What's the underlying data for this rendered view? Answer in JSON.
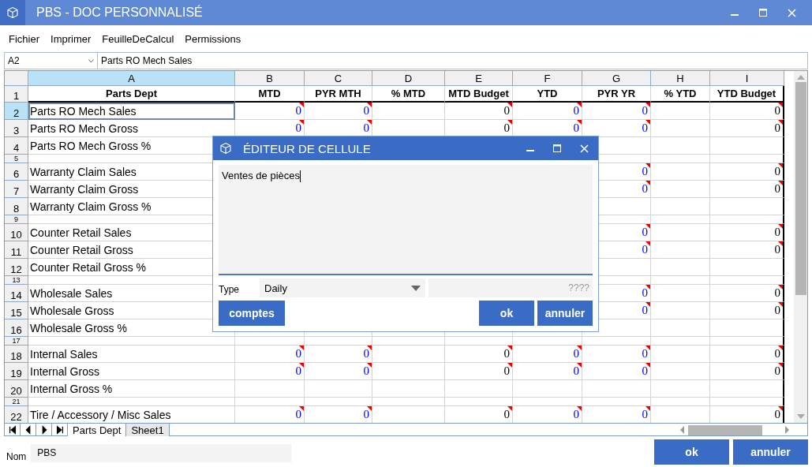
{
  "window": {
    "title": "PBS - DOC PERSONNALISÉ"
  },
  "menu": [
    "Fichier",
    "Imprimer",
    "FeuilleDeCalcul",
    "Permissions"
  ],
  "name_box": {
    "value": "A2"
  },
  "formula_bar": {
    "value": "Parts RO Mech Sales"
  },
  "columns": [
    {
      "letter": "A",
      "selected": true
    },
    {
      "letter": "B",
      "selected": false
    },
    {
      "letter": "C",
      "selected": false
    },
    {
      "letter": "D",
      "selected": false
    },
    {
      "letter": "E",
      "selected": false
    },
    {
      "letter": "F",
      "selected": false
    },
    {
      "letter": "G",
      "selected": false
    },
    {
      "letter": "H",
      "selected": false
    },
    {
      "letter": "I",
      "selected": false
    }
  ],
  "rows": [
    {
      "number": "1",
      "kind": "header",
      "selected": false,
      "cells": [
        {
          "kind": "text",
          "value": "Parts Dept"
        },
        {
          "kind": "text",
          "value": "MTD"
        },
        {
          "kind": "text",
          "value": "PYR MTH"
        },
        {
          "kind": "text",
          "value": "% MTD"
        },
        {
          "kind": "text",
          "value": "MTD Budget"
        },
        {
          "kind": "text",
          "value": "YTD"
        },
        {
          "kind": "text",
          "value": "PYR YR"
        },
        {
          "kind": "text",
          "value": "% YTD"
        },
        {
          "kind": "text",
          "value": "YTD Budget"
        }
      ]
    },
    {
      "number": "2",
      "kind": "data",
      "selected": true,
      "cells": [
        {
          "kind": "text",
          "value": "Parts RO Mech Sales"
        },
        {
          "kind": "number",
          "value": "0",
          "color": "#0000ff"
        },
        {
          "kind": "number",
          "value": "0",
          "color": "#0000ff"
        },
        {
          "kind": "empty"
        },
        {
          "kind": "number",
          "value": "0",
          "color": "#000000"
        },
        {
          "kind": "number",
          "value": "0",
          "color": "#0000ff"
        },
        {
          "kind": "number",
          "value": "0",
          "color": "#0000ff"
        },
        {
          "kind": "empty"
        },
        {
          "kind": "number",
          "value": "0",
          "color": "#000000"
        }
      ]
    },
    {
      "number": "3",
      "kind": "data",
      "selected": false,
      "cells": [
        {
          "kind": "text",
          "value": "Parts RO Mech Gross"
        },
        {
          "kind": "number",
          "value": "0",
          "color": "#0000ff"
        },
        {
          "kind": "number",
          "value": "0",
          "color": "#0000ff"
        },
        {
          "kind": "empty"
        },
        {
          "kind": "number",
          "value": "0",
          "color": "#000000"
        },
        {
          "kind": "number",
          "value": "0",
          "color": "#0000ff"
        },
        {
          "kind": "number",
          "value": "0",
          "color": "#0000ff"
        },
        {
          "kind": "empty"
        },
        {
          "kind": "number",
          "value": "0",
          "color": "#000000"
        }
      ]
    },
    {
      "number": "4",
      "kind": "data",
      "selected": false,
      "cells": [
        {
          "kind": "text",
          "value": "Parts RO Mech Gross %"
        },
        {
          "kind": "hidden"
        },
        {
          "kind": "hidden"
        },
        {
          "kind": "hidden"
        },
        {
          "kind": "hidden"
        },
        {
          "kind": "hidden"
        },
        {
          "kind": "empty"
        },
        {
          "kind": "empty"
        },
        {
          "kind": "empty"
        }
      ]
    },
    {
      "number": "5",
      "kind": "spacer",
      "selected": false,
      "cells": [
        {
          "kind": "empty"
        },
        {
          "kind": "hidden"
        },
        {
          "kind": "hidden"
        },
        {
          "kind": "hidden"
        },
        {
          "kind": "hidden"
        },
        {
          "kind": "hidden"
        },
        {
          "kind": "empty"
        },
        {
          "kind": "empty"
        },
        {
          "kind": "empty"
        }
      ]
    },
    {
      "number": "6",
      "kind": "data",
      "selected": false,
      "cells": [
        {
          "kind": "text",
          "value": "Warranty Claim Sales"
        },
        {
          "kind": "hidden"
        },
        {
          "kind": "hidden"
        },
        {
          "kind": "hidden"
        },
        {
          "kind": "hidden"
        },
        {
          "kind": "hidden"
        },
        {
          "kind": "number",
          "value": "0",
          "color": "#0000ff"
        },
        {
          "kind": "empty"
        },
        {
          "kind": "number",
          "value": "0",
          "color": "#000000"
        }
      ]
    },
    {
      "number": "7",
      "kind": "data",
      "selected": false,
      "cells": [
        {
          "kind": "text",
          "value": "Warranty Claim Gross"
        },
        {
          "kind": "hidden"
        },
        {
          "kind": "hidden"
        },
        {
          "kind": "hidden"
        },
        {
          "kind": "hidden"
        },
        {
          "kind": "hidden"
        },
        {
          "kind": "number",
          "value": "0",
          "color": "#0000ff"
        },
        {
          "kind": "empty"
        },
        {
          "kind": "number",
          "value": "0",
          "color": "#000000"
        }
      ]
    },
    {
      "number": "8",
      "kind": "data",
      "selected": false,
      "cells": [
        {
          "kind": "text",
          "value": "Warranty Claim Gross %"
        },
        {
          "kind": "hidden"
        },
        {
          "kind": "hidden"
        },
        {
          "kind": "hidden"
        },
        {
          "kind": "hidden"
        },
        {
          "kind": "hidden"
        },
        {
          "kind": "empty"
        },
        {
          "kind": "empty"
        },
        {
          "kind": "empty"
        }
      ]
    },
    {
      "number": "9",
      "kind": "spacer",
      "selected": false,
      "cells": [
        {
          "kind": "empty"
        },
        {
          "kind": "hidden"
        },
        {
          "kind": "hidden"
        },
        {
          "kind": "hidden"
        },
        {
          "kind": "hidden"
        },
        {
          "kind": "hidden"
        },
        {
          "kind": "empty"
        },
        {
          "kind": "empty"
        },
        {
          "kind": "empty"
        }
      ]
    },
    {
      "number": "10",
      "kind": "data",
      "selected": false,
      "cells": [
        {
          "kind": "text",
          "value": "Counter Retail Sales"
        },
        {
          "kind": "hidden"
        },
        {
          "kind": "hidden"
        },
        {
          "kind": "hidden"
        },
        {
          "kind": "hidden"
        },
        {
          "kind": "hidden"
        },
        {
          "kind": "number",
          "value": "0",
          "color": "#0000ff"
        },
        {
          "kind": "empty"
        },
        {
          "kind": "number",
          "value": "0",
          "color": "#000000"
        }
      ]
    },
    {
      "number": "11",
      "kind": "data",
      "selected": false,
      "cells": [
        {
          "kind": "text",
          "value": "Counter Retail Gross"
        },
        {
          "kind": "hidden"
        },
        {
          "kind": "hidden"
        },
        {
          "kind": "hidden"
        },
        {
          "kind": "hidden"
        },
        {
          "kind": "hidden"
        },
        {
          "kind": "number",
          "value": "0",
          "color": "#0000ff"
        },
        {
          "kind": "empty"
        },
        {
          "kind": "number",
          "value": "0",
          "color": "#000000"
        }
      ]
    },
    {
      "number": "12",
      "kind": "data",
      "selected": false,
      "cells": [
        {
          "kind": "text",
          "value": "Counter Retail Gross %"
        },
        {
          "kind": "hidden"
        },
        {
          "kind": "hidden"
        },
        {
          "kind": "hidden"
        },
        {
          "kind": "hidden"
        },
        {
          "kind": "hidden"
        },
        {
          "kind": "empty"
        },
        {
          "kind": "empty"
        },
        {
          "kind": "empty"
        }
      ]
    },
    {
      "number": "13",
      "kind": "spacer",
      "selected": false,
      "cells": [
        {
          "kind": "empty"
        },
        {
          "kind": "hidden"
        },
        {
          "kind": "hidden"
        },
        {
          "kind": "hidden"
        },
        {
          "kind": "hidden"
        },
        {
          "kind": "hidden"
        },
        {
          "kind": "empty"
        },
        {
          "kind": "empty"
        },
        {
          "kind": "empty"
        }
      ]
    },
    {
      "number": "14",
      "kind": "data",
      "selected": false,
      "cells": [
        {
          "kind": "text",
          "value": "Wholesale Sales"
        },
        {
          "kind": "hidden"
        },
        {
          "kind": "hidden"
        },
        {
          "kind": "hidden"
        },
        {
          "kind": "hidden"
        },
        {
          "kind": "hidden"
        },
        {
          "kind": "number",
          "value": "0",
          "color": "#0000ff"
        },
        {
          "kind": "empty"
        },
        {
          "kind": "number",
          "value": "0",
          "color": "#000000"
        }
      ]
    },
    {
      "number": "15",
      "kind": "data",
      "selected": false,
      "cells": [
        {
          "kind": "text",
          "value": "Wholesale Gross"
        },
        {
          "kind": "hidden"
        },
        {
          "kind": "hidden"
        },
        {
          "kind": "hidden"
        },
        {
          "kind": "hidden"
        },
        {
          "kind": "hidden"
        },
        {
          "kind": "number",
          "value": "0",
          "color": "#0000ff"
        },
        {
          "kind": "empty"
        },
        {
          "kind": "number",
          "value": "0",
          "color": "#000000"
        }
      ]
    },
    {
      "number": "16",
      "kind": "data",
      "selected": false,
      "cells": [
        {
          "kind": "text",
          "value": "Wholesale Gross %"
        },
        {
          "kind": "empty"
        },
        {
          "kind": "empty"
        },
        {
          "kind": "empty"
        },
        {
          "kind": "empty"
        },
        {
          "kind": "empty"
        },
        {
          "kind": "empty"
        },
        {
          "kind": "empty"
        },
        {
          "kind": "empty"
        }
      ]
    },
    {
      "number": "17",
      "kind": "spacer",
      "selected": false,
      "cells": [
        {
          "kind": "empty"
        },
        {
          "kind": "empty"
        },
        {
          "kind": "empty"
        },
        {
          "kind": "empty"
        },
        {
          "kind": "empty"
        },
        {
          "kind": "empty"
        },
        {
          "kind": "empty"
        },
        {
          "kind": "empty"
        },
        {
          "kind": "empty"
        }
      ]
    },
    {
      "number": "18",
      "kind": "data",
      "selected": false,
      "cells": [
        {
          "kind": "text",
          "value": "Internal Sales"
        },
        {
          "kind": "number",
          "value": "0",
          "color": "#0000ff"
        },
        {
          "kind": "number",
          "value": "0",
          "color": "#0000ff"
        },
        {
          "kind": "empty"
        },
        {
          "kind": "number",
          "value": "0",
          "color": "#000000"
        },
        {
          "kind": "number",
          "value": "0",
          "color": "#0000ff"
        },
        {
          "kind": "number",
          "value": "0",
          "color": "#0000ff"
        },
        {
          "kind": "empty"
        },
        {
          "kind": "number",
          "value": "0",
          "color": "#000000"
        }
      ]
    },
    {
      "number": "19",
      "kind": "data",
      "selected": false,
      "cells": [
        {
          "kind": "text",
          "value": "Internal Gross"
        },
        {
          "kind": "number",
          "value": "0",
          "color": "#0000ff"
        },
        {
          "kind": "number",
          "value": "0",
          "color": "#0000ff"
        },
        {
          "kind": "empty"
        },
        {
          "kind": "number",
          "value": "0",
          "color": "#000000"
        },
        {
          "kind": "number",
          "value": "0",
          "color": "#0000ff"
        },
        {
          "kind": "number",
          "value": "0",
          "color": "#0000ff"
        },
        {
          "kind": "empty"
        },
        {
          "kind": "number",
          "value": "0",
          "color": "#000000"
        }
      ]
    },
    {
      "number": "20",
      "kind": "data",
      "selected": false,
      "cells": [
        {
          "kind": "text",
          "value": "Internal Gross %"
        },
        {
          "kind": "empty"
        },
        {
          "kind": "empty"
        },
        {
          "kind": "empty"
        },
        {
          "kind": "empty"
        },
        {
          "kind": "empty"
        },
        {
          "kind": "empty"
        },
        {
          "kind": "empty"
        },
        {
          "kind": "empty"
        }
      ]
    },
    {
      "number": "21",
      "kind": "spacer",
      "selected": false,
      "cells": [
        {
          "kind": "empty"
        },
        {
          "kind": "empty"
        },
        {
          "kind": "empty"
        },
        {
          "kind": "empty"
        },
        {
          "kind": "empty"
        },
        {
          "kind": "empty"
        },
        {
          "kind": "empty"
        },
        {
          "kind": "empty"
        },
        {
          "kind": "empty"
        }
      ]
    },
    {
      "number": "22",
      "kind": "data",
      "selected": false,
      "cells": [
        {
          "kind": "text",
          "value": "Tire / Accessory / Misc Sales"
        },
        {
          "kind": "number",
          "value": "0",
          "color": "#0000ff"
        },
        {
          "kind": "number",
          "value": "0",
          "color": "#0000ff"
        },
        {
          "kind": "empty"
        },
        {
          "kind": "number",
          "value": "0",
          "color": "#000000"
        },
        {
          "kind": "number",
          "value": "0",
          "color": "#0000ff"
        },
        {
          "kind": "number",
          "value": "0",
          "color": "#0000ff"
        },
        {
          "kind": "empty"
        },
        {
          "kind": "number",
          "value": "0",
          "color": "#000000"
        }
      ]
    }
  ],
  "sheet_tabs": [
    {
      "label": "Parts Dept",
      "selected": true
    },
    {
      "label": "Sheet1",
      "selected": false
    }
  ],
  "name_field": {
    "label": "Nom",
    "value": "PBS"
  },
  "buttons": [
    "ok",
    "annuler"
  ],
  "cell_editor": {
    "title": "ÉDITEUR DE CELLULE",
    "text": "Ventes de pièces",
    "type_label": "Type",
    "type_value": "Daily",
    "code_placeholder": "????",
    "buttons": [
      "comptes",
      "ok",
      "annuler"
    ]
  }
}
